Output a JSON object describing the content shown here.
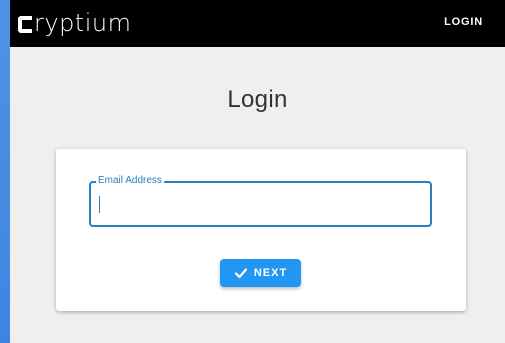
{
  "app": {
    "brand_name": "ryptium",
    "brand_icon": "cryptium-c-logo-icon"
  },
  "topbar": {
    "login_label": "LOGIN"
  },
  "page": {
    "title": "Login"
  },
  "form": {
    "email_label": "Email Address",
    "email_value": "",
    "next_label": "NEXT",
    "next_icon": "check-icon"
  },
  "colors": {
    "topbar_bg": "#000000",
    "page_bg": "#efefef",
    "accent": "#2196f3",
    "field_border": "#2a7fc0"
  }
}
